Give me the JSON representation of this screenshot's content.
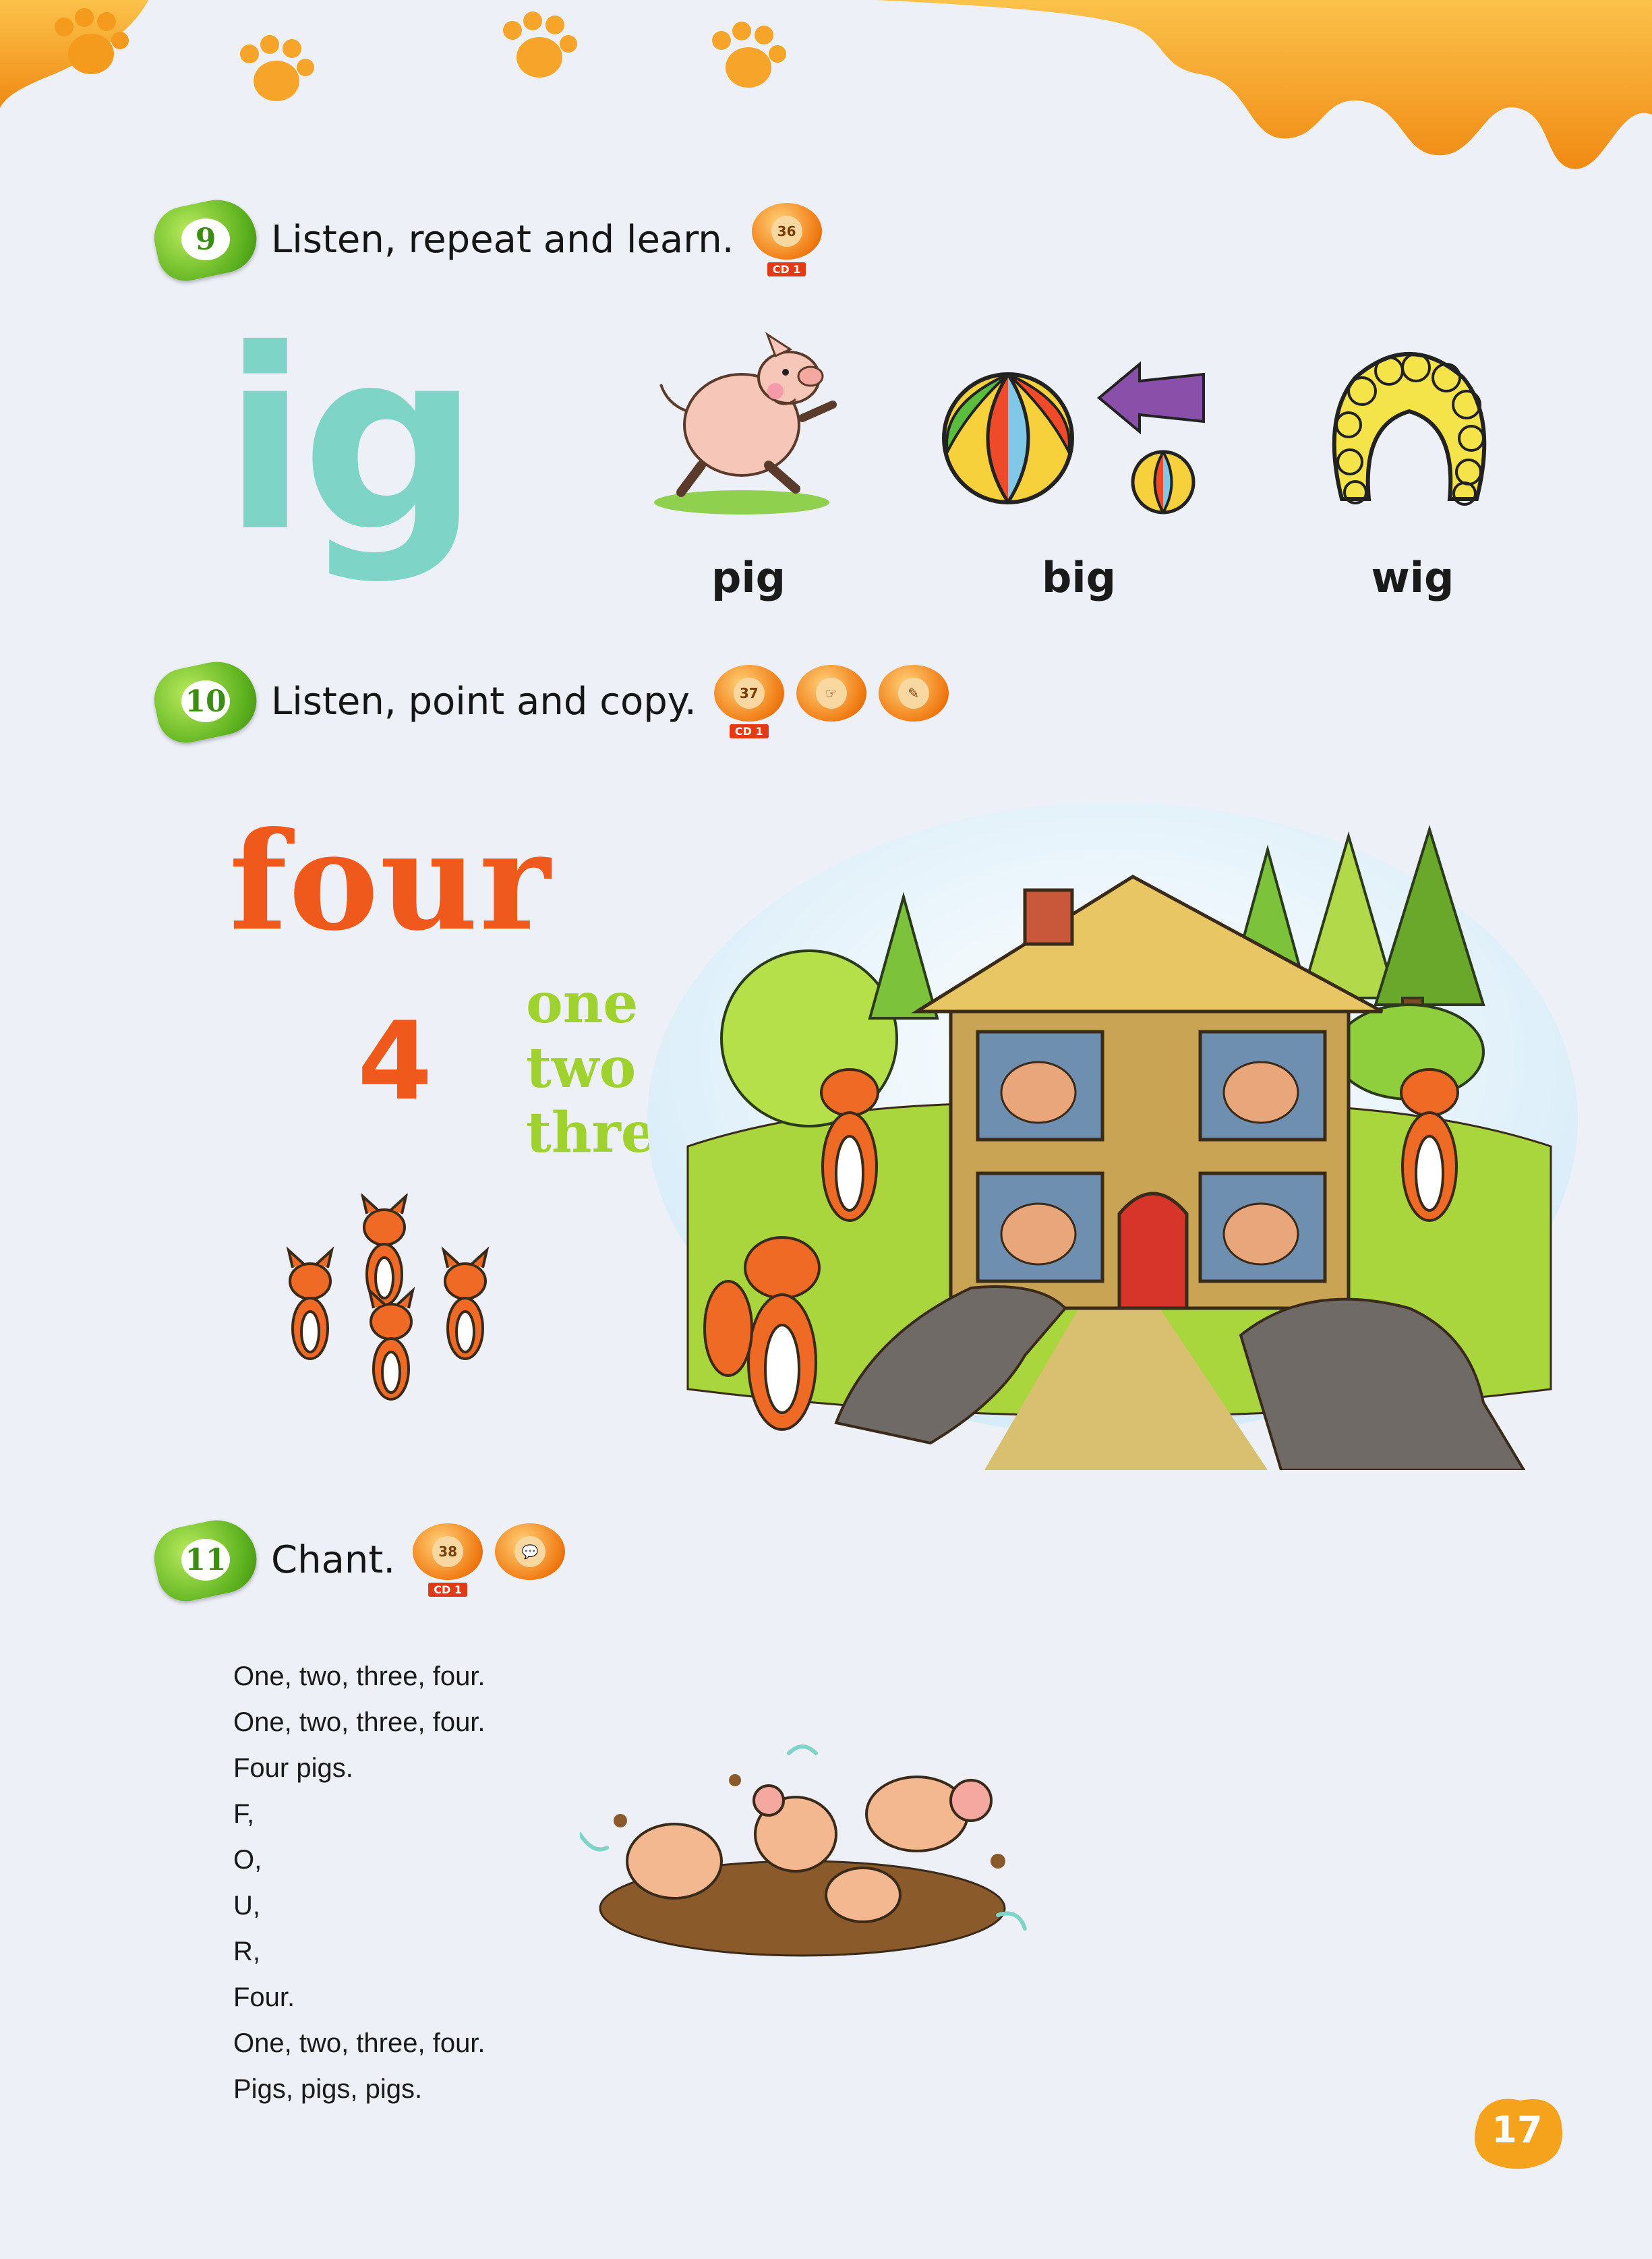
{
  "exercises": [
    {
      "number": "9",
      "title": "Listen, repeat and learn.",
      "track": "36",
      "cd": "CD 1"
    },
    {
      "number": "10",
      "title": "Listen, point and copy.",
      "track": "37",
      "cd": "CD 1"
    },
    {
      "number": "11",
      "title": "Chant.",
      "track": "38",
      "cd": "CD 1"
    }
  ],
  "phonics": {
    "sound": "ig",
    "words": [
      "pig",
      "big",
      "wig"
    ]
  },
  "number_lesson": {
    "word": "four",
    "digit": "4",
    "count_words": [
      "one",
      "two",
      "three"
    ]
  },
  "chant_lines": [
    "One, two, three, four.",
    "One, two, three, four.",
    "Four pigs.",
    "F,",
    "O,",
    "U,",
    "R,",
    "Four.",
    "One, two, three, four.",
    "Pigs, pigs, pigs."
  ],
  "page_number": "17",
  "colors": {
    "drip": "#f59a1d",
    "exercise_badge": "#5cb11e",
    "ig": "#7fd4c8",
    "four": "#ef5a1c",
    "count_words": "#9fd12f"
  }
}
